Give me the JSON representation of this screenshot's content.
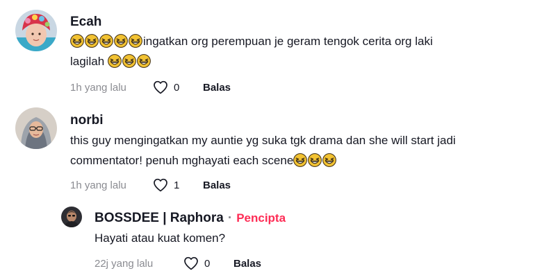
{
  "comments": [
    {
      "username": "Ecah",
      "line1_text": "ingatkan org perempuan je geram tengok cerita org laki",
      "line2_text": "lagilah",
      "time": "1h yang lalu",
      "likes": "0",
      "reply_label": "Balas"
    },
    {
      "username": "norbi",
      "line1_text": "this guy mengingatkan my auntie yg suka tgk drama dan she will start jadi",
      "line2_text": "commentator! penuh mghayati each scene",
      "time": "1h yang lalu",
      "likes": "1",
      "reply_label": "Balas"
    }
  ],
  "reply": {
    "username": "BOSSDEE | Raphora",
    "separator": "·",
    "creator_label": "Pencipta",
    "text": "Hayati atau kuat komen?",
    "time": "22j yang lalu",
    "likes": "0",
    "reply_label": "Balas"
  },
  "colors": {
    "creator_accent": "#fe2c55",
    "meta_gray": "#8a8b91",
    "text": "#161823"
  },
  "icons": {
    "emoji": "grinning-squinting-face-icon",
    "like": "heart-outline-icon"
  }
}
